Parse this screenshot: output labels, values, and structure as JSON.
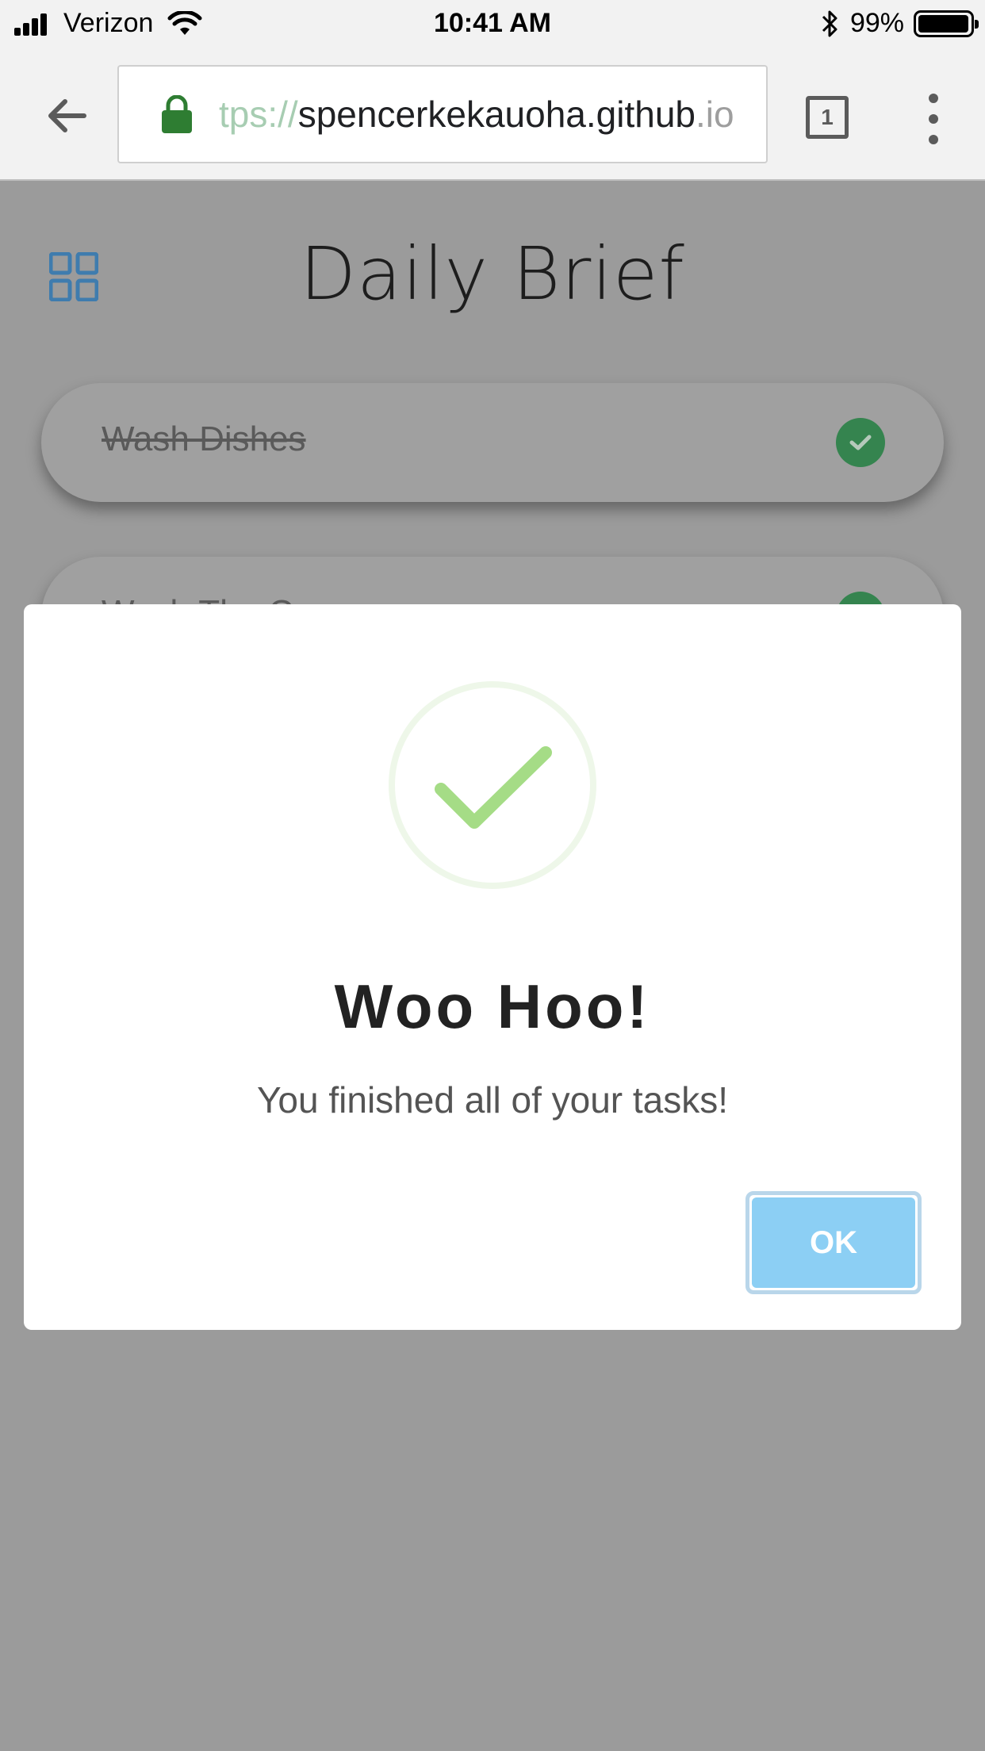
{
  "status_bar": {
    "carrier": "Verizon",
    "time": "10:41 AM",
    "battery_percent": "99%",
    "battery_level": 0.99
  },
  "browser": {
    "url_scheme_fragment": "tps://",
    "url_host": "spencerkekauoha.github",
    "url_tail": ".io",
    "tab_count": "1"
  },
  "page": {
    "title": "Daily Brief",
    "tasks": [
      {
        "label": "Wash Dishes",
        "done": true
      },
      {
        "label": "Wash The Car",
        "done": true
      }
    ]
  },
  "modal": {
    "title": "Woo Hoo!",
    "message": "You finished all of your tasks!",
    "ok_label": "OK"
  },
  "colors": {
    "overlay": "#9b9b9b",
    "check_green": "#35844f",
    "success_check": "#a5dc86",
    "ok_button": "#8ccff4",
    "grid_icon": "#3f7cae",
    "lock": "#2e7d32"
  }
}
